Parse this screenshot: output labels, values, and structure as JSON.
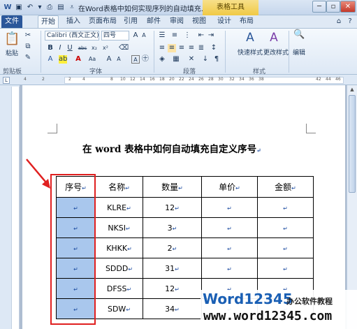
{
  "window": {
    "title": "在Word表格中如何实现序列的自动填充.docx M...",
    "context_tab": "表格工具",
    "help_icon": "?"
  },
  "tabs": [
    {
      "label": "文件"
    },
    {
      "label": "开始"
    },
    {
      "label": "插入"
    },
    {
      "label": "页面布局"
    },
    {
      "label": "引用"
    },
    {
      "label": "邮件"
    },
    {
      "label": "审阅"
    },
    {
      "label": "视图"
    },
    {
      "label": "设计"
    },
    {
      "label": "布局"
    }
  ],
  "ribbon": {
    "paste_label": "粘贴",
    "font_name": "Calibri (西文正文)",
    "font_size": "四号",
    "group_clipboard": "剪贴板",
    "group_font": "字体",
    "group_paragraph": "段落",
    "group_styles": "样式",
    "quick_styles": "快速样式",
    "change_styles": "更改样式",
    "edit": "编辑",
    "bold": "B",
    "italic": "I",
    "underline": "U",
    "strike": "abc",
    "sub": "x₂",
    "sup": "x²",
    "font_color": "A",
    "grow": "A",
    "shrink": "A",
    "case": "Aa",
    "clear": "A"
  },
  "ruler": {
    "ticks": [
      "4",
      "2",
      "2",
      "4",
      "8",
      "10",
      "12",
      "14",
      "16",
      "18",
      "20",
      "22",
      "24",
      "26",
      "28",
      "30",
      "32",
      "34",
      "36",
      "38",
      "42",
      "44",
      "46"
    ]
  },
  "document": {
    "heading": "在 word 表格中如何自动填充自定义序号",
    "para_mark": "↵",
    "table": {
      "headers": [
        "序号",
        "名称",
        "数量",
        "单价",
        "金额"
      ],
      "rows": [
        [
          "",
          "KLRE",
          "12",
          "",
          ""
        ],
        [
          "",
          "NKSI",
          "3",
          "",
          ""
        ],
        [
          "",
          "KHKK",
          "2",
          "",
          ""
        ],
        [
          "",
          "SDDD",
          "31",
          "",
          ""
        ],
        [
          "",
          "DFSS",
          "12",
          "",
          ""
        ],
        [
          "",
          "SDW",
          "34",
          "",
          ""
        ]
      ]
    }
  },
  "watermark": {
    "brand": "Word12345",
    "sub": "办公软件教程",
    "url": "www.word12345.com"
  },
  "colors": {
    "selection": "#a9c7ed",
    "highlight_box": "#e02020",
    "file_tab": "#2b579a"
  }
}
